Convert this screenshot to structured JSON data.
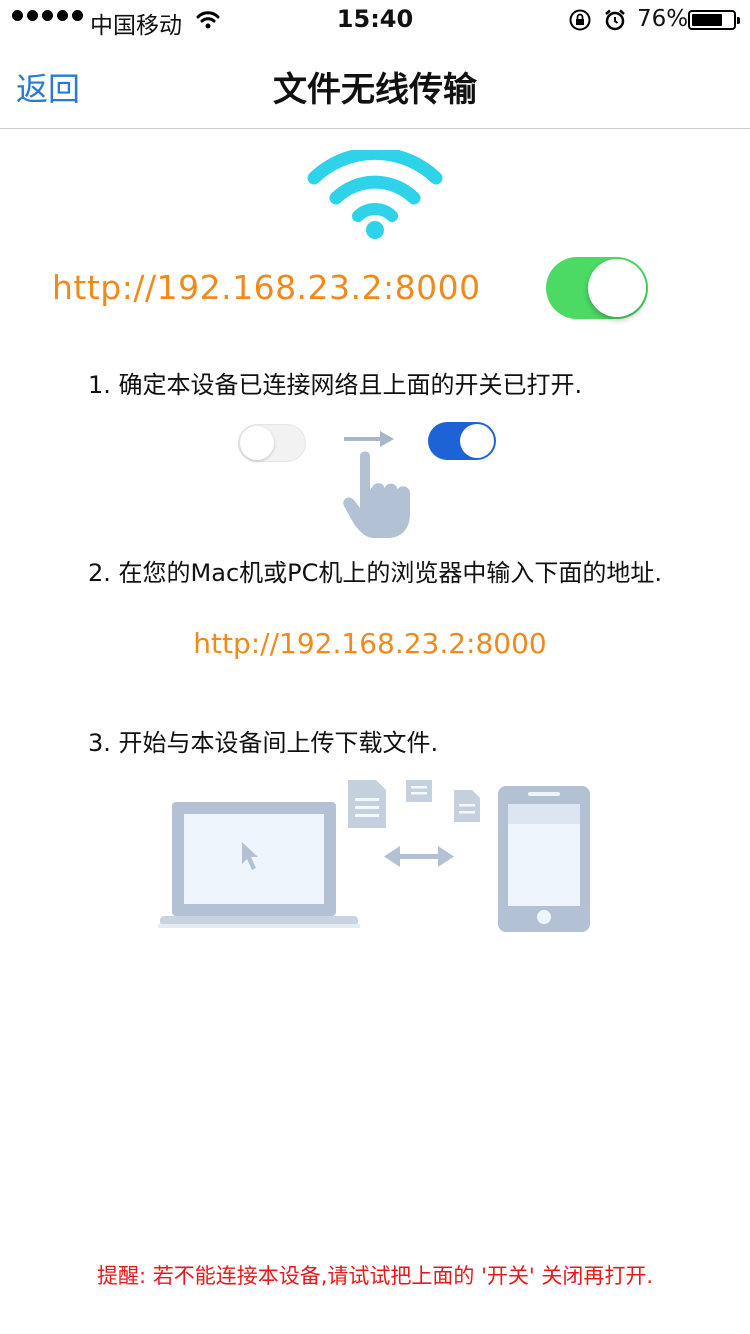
{
  "status_bar": {
    "carrier": "中国移动",
    "time": "15:40",
    "battery_percent": "76%",
    "battery_level": 0.76,
    "icons": [
      "signal-dots-icon",
      "wifi-icon",
      "rotation-lock-icon",
      "alarm-icon",
      "battery-icon"
    ]
  },
  "nav": {
    "back_label": "返回",
    "title": "文件无线传输"
  },
  "server": {
    "url": "http://192.168.23.2:8000",
    "switch_on": true
  },
  "steps": {
    "step1": "1. 确定本设备已连接网络且上面的开关已打开.",
    "step2": "2. 在您的Mac机或PC机上的浏览器中输入下面的地址.",
    "step2_url": "http://192.168.23.2:8000",
    "step3": "3. 开始与本设备间上传下载文件."
  },
  "tip": "提醒: 若不能连接本设备,请试试把上面的 '开关' 关闭再打开.",
  "colors": {
    "accent_blue": "#2a7ad5",
    "url_orange": "#f08a1c",
    "switch_green": "#4cd964",
    "tip_red": "#e8191b",
    "wifi_cyan": "#2ed3ea",
    "illustration_gray": "#b2c1d4"
  }
}
